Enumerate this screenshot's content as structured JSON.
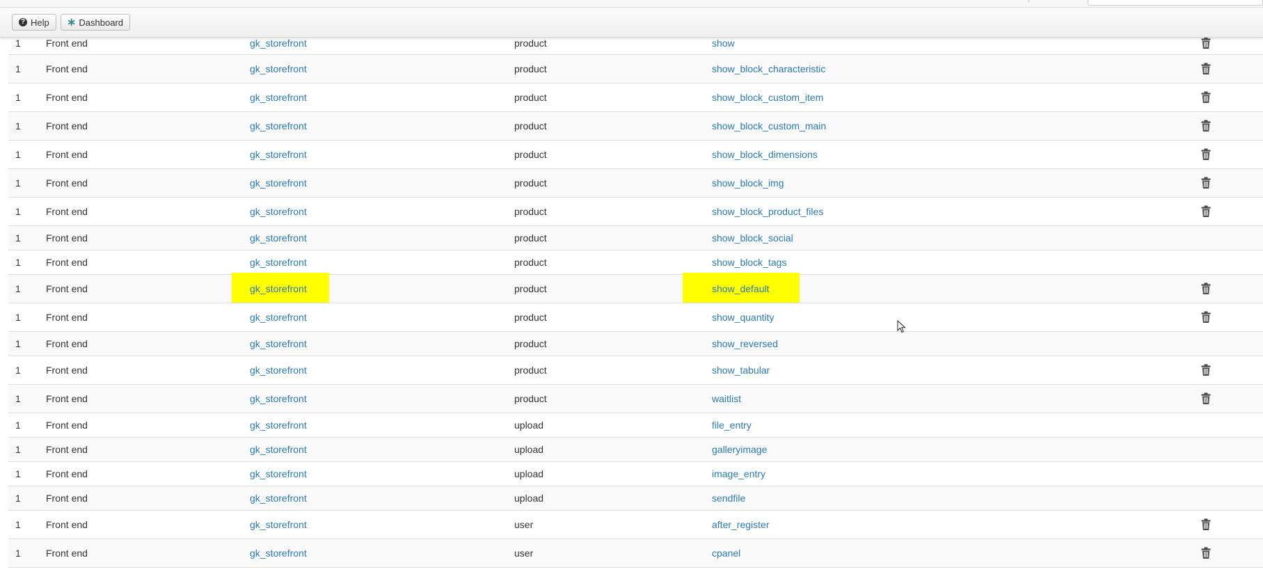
{
  "toolbar": {
    "help_label": "Help",
    "dashboard_label": "Dashboard"
  },
  "icons": {
    "help": "question-circle-icon",
    "dashboard": "asterisk-icon",
    "delete": "trash-icon"
  },
  "colors": {
    "link": "#2a7ab9",
    "highlight": "#ffff00",
    "text": "#333333"
  },
  "rows": [
    {
      "num": "1",
      "section": "Front end",
      "template": "gk_storefront",
      "controller": "product",
      "action": "show",
      "deletable": true,
      "highlight": false,
      "height": 34
    },
    {
      "num": "1",
      "section": "Front end",
      "template": "gk_storefront",
      "controller": "product",
      "action": "show_block_characteristic",
      "deletable": true,
      "highlight": false,
      "height": 41
    },
    {
      "num": "1",
      "section": "Front end",
      "template": "gk_storefront",
      "controller": "product",
      "action": "show_block_custom_item",
      "deletable": true,
      "highlight": false,
      "height": 41
    },
    {
      "num": "1",
      "section": "Front end",
      "template": "gk_storefront",
      "controller": "product",
      "action": "show_block_custom_main",
      "deletable": true,
      "highlight": false,
      "height": 41
    },
    {
      "num": "1",
      "section": "Front end",
      "template": "gk_storefront",
      "controller": "product",
      "action": "show_block_dimensions",
      "deletable": true,
      "highlight": false,
      "height": 41
    },
    {
      "num": "1",
      "section": "Front end",
      "template": "gk_storefront",
      "controller": "product",
      "action": "show_block_img",
      "deletable": true,
      "highlight": false,
      "height": 41
    },
    {
      "num": "1",
      "section": "Front end",
      "template": "gk_storefront",
      "controller": "product",
      "action": "show_block_product_files",
      "deletable": true,
      "highlight": false,
      "height": 41
    },
    {
      "num": "1",
      "section": "Front end",
      "template": "gk_storefront",
      "controller": "product",
      "action": "show_block_social",
      "deletable": false,
      "highlight": false,
      "height": 35
    },
    {
      "num": "1",
      "section": "Front end",
      "template": "gk_storefront",
      "controller": "product",
      "action": "show_block_tags",
      "deletable": false,
      "highlight": false,
      "height": 35
    },
    {
      "num": "1",
      "section": "Front end",
      "template": "gk_storefront",
      "controller": "product",
      "action": "show_default",
      "deletable": true,
      "highlight": true,
      "height": 41
    },
    {
      "num": "1",
      "section": "Front end",
      "template": "gk_storefront",
      "controller": "product",
      "action": "show_quantity",
      "deletable": true,
      "highlight": false,
      "height": 41
    },
    {
      "num": "1",
      "section": "Front end",
      "template": "gk_storefront",
      "controller": "product",
      "action": "show_reversed",
      "deletable": false,
      "highlight": false,
      "height": 35
    },
    {
      "num": "1",
      "section": "Front end",
      "template": "gk_storefront",
      "controller": "product",
      "action": "show_tabular",
      "deletable": true,
      "highlight": false,
      "height": 41
    },
    {
      "num": "1",
      "section": "Front end",
      "template": "gk_storefront",
      "controller": "product",
      "action": "waitlist",
      "deletable": true,
      "highlight": false,
      "height": 41
    },
    {
      "num": "1",
      "section": "Front end",
      "template": "gk_storefront",
      "controller": "upload",
      "action": "file_entry",
      "deletable": false,
      "highlight": false,
      "height": 35
    },
    {
      "num": "1",
      "section": "Front end",
      "template": "gk_storefront",
      "controller": "upload",
      "action": "galleryimage",
      "deletable": false,
      "highlight": false,
      "height": 35
    },
    {
      "num": "1",
      "section": "Front end",
      "template": "gk_storefront",
      "controller": "upload",
      "action": "image_entry",
      "deletable": false,
      "highlight": false,
      "height": 35
    },
    {
      "num": "1",
      "section": "Front end",
      "template": "gk_storefront",
      "controller": "upload",
      "action": "sendfile",
      "deletable": false,
      "highlight": false,
      "height": 35
    },
    {
      "num": "1",
      "section": "Front end",
      "template": "gk_storefront",
      "controller": "user",
      "action": "after_register",
      "deletable": true,
      "highlight": false,
      "height": 41
    },
    {
      "num": "1",
      "section": "Front end",
      "template": "gk_storefront",
      "controller": "user",
      "action": "cpanel",
      "deletable": true,
      "highlight": false,
      "height": 41
    }
  ]
}
